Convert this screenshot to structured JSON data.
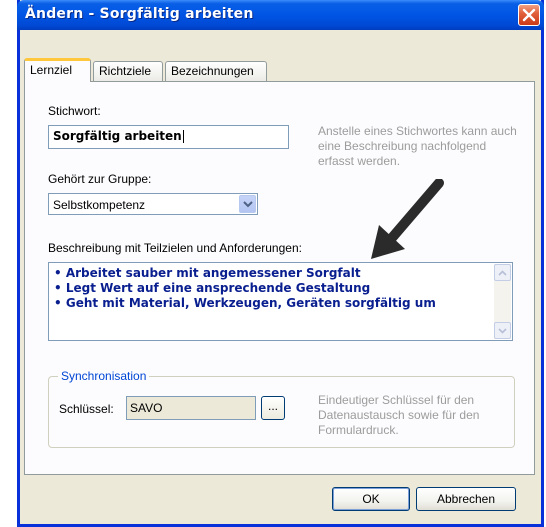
{
  "window": {
    "title": "Ändern - Sorgfältig arbeiten",
    "close": "×"
  },
  "tabs": [
    {
      "label": "Lernziel",
      "active": true
    },
    {
      "label": "Richtziele",
      "active": false
    },
    {
      "label": "Bezeichnungen",
      "active": false
    }
  ],
  "form": {
    "keyword_label": "Stichwort:",
    "keyword_value": "Sorgfältig arbeiten",
    "keyword_hint": "Anstelle eines Stichwortes kann auch eine Beschreibung nachfolgend erfasst werden.",
    "group_label": "Gehört zur Gruppe:",
    "group_value": "Selbstkompetenz",
    "description_label": "Beschreibung mit Teilzielen und Anforderungen:",
    "description_lines": [
      "• Arbeitet sauber mit angemessener Sorgfalt",
      "• Legt Wert auf eine ansprechende Gestaltung",
      "• Geht mit Material, Werkzeugen, Geräten sorgfältig um"
    ]
  },
  "sync": {
    "title": "Synchronisation",
    "key_label": "Schlüssel:",
    "key_value": "SAVO",
    "browse_label": "...",
    "hint": "Eindeutiger Schlüssel für den Datenaustausch sowie für den Formulardruck."
  },
  "buttons": {
    "ok": "OK",
    "cancel": "Abbrechen"
  },
  "colors": {
    "titlebar": "#0055e5",
    "description_text": "#0a1f8f",
    "group_title": "#0046d5",
    "hint_text": "#9c9c9c",
    "active_tab_accent": "#ffc83c"
  }
}
